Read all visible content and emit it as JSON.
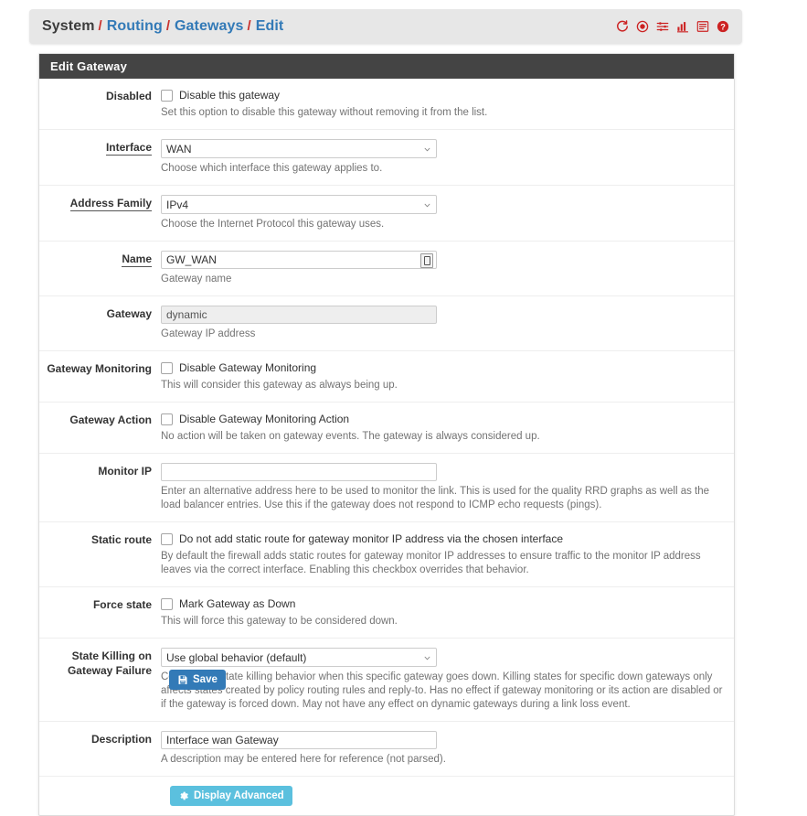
{
  "breadcrumb": {
    "items": [
      {
        "label": "System",
        "link": false
      },
      {
        "label": "Routing",
        "link": true
      },
      {
        "label": "Gateways",
        "link": true
      },
      {
        "label": "Edit",
        "link": true
      }
    ],
    "separator": "/",
    "icons": [
      {
        "name": "restart-icon"
      },
      {
        "name": "stop-icon"
      },
      {
        "name": "sliders-icon"
      },
      {
        "name": "bar-chart-icon"
      },
      {
        "name": "list-icon"
      },
      {
        "name": "help-icon"
      }
    ],
    "icon_color": "#cc2222",
    "link_color": "#337ab7",
    "separator_color": "#c9302c"
  },
  "panel": {
    "title": "Edit Gateway"
  },
  "form": {
    "disabled": {
      "label": "Disabled",
      "checkbox_label": "Disable this gateway",
      "checked": false,
      "help": "Set this option to disable this gateway without removing it from the list."
    },
    "interface": {
      "label": "Interface",
      "required": true,
      "value": "WAN",
      "help": "Choose which interface this gateway applies to."
    },
    "address_family": {
      "label": "Address Family",
      "required": true,
      "value": "IPv4",
      "help": "Choose the Internet Protocol this gateway uses."
    },
    "name": {
      "label": "Name",
      "required": true,
      "value": "GW_WAN",
      "help": "Gateway name",
      "addon_icon": "password-manager-icon"
    },
    "gateway": {
      "label": "Gateway",
      "value": "dynamic",
      "disabled": true,
      "help": "Gateway IP address"
    },
    "gateway_monitoring": {
      "label": "Gateway Monitoring",
      "checkbox_label": "Disable Gateway Monitoring",
      "checked": false,
      "help": "This will consider this gateway as always being up."
    },
    "gateway_action": {
      "label": "Gateway Action",
      "checkbox_label": "Disable Gateway Monitoring Action",
      "checked": false,
      "help": "No action will be taken on gateway events. The gateway is always considered up."
    },
    "monitor_ip": {
      "label": "Monitor IP",
      "value": "",
      "placeholder": "",
      "help": "Enter an alternative address here to be used to monitor the link. This is used for the quality RRD graphs as well as the load balancer entries. Use this if the gateway does not respond to ICMP echo requests (pings)."
    },
    "static_route": {
      "label": "Static route",
      "checkbox_label": "Do not add static route for gateway monitor IP address via the chosen interface",
      "checked": false,
      "help": "By default the firewall adds static routes for gateway monitor IP addresses to ensure traffic to the monitor IP address leaves via the correct interface. Enabling this checkbox overrides that behavior."
    },
    "force_state": {
      "label": "Force state",
      "checkbox_label": "Mark Gateway as Down",
      "checked": false,
      "help": "This will force this gateway to be considered down."
    },
    "state_killing": {
      "label": "State Killing on Gateway Failure",
      "value": "Use global behavior (default)",
      "help": "Controls the state killing behavior when this specific gateway goes down. Killing states for specific down gateways only affects states created by policy routing rules and reply-to. Has no effect if gateway monitoring or its action are disabled or if the gateway is forced down. May not have any effect on dynamic gateways during a link loss event."
    },
    "description": {
      "label": "Description",
      "value": "Interface wan Gateway",
      "help": "A description may be entered here for reference (not parsed)."
    }
  },
  "buttons": {
    "display_advanced": {
      "label": "Display Advanced",
      "icon": "gear-icon",
      "color": "#5bc0de"
    },
    "save": {
      "label": "Save",
      "icon": "save-icon",
      "color": "#337ab7"
    }
  }
}
